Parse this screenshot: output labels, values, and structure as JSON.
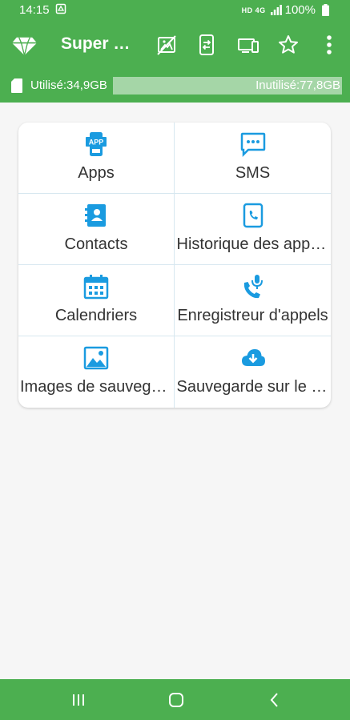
{
  "status_bar": {
    "time": "14:15",
    "network": "HD 4G",
    "battery": "100%"
  },
  "app_bar": {
    "title": "Super Backup",
    "icons": [
      "diamond-logo-icon",
      "no-image-icon",
      "phone-transfer-icon",
      "devices-icon",
      "star-icon",
      "more-vert-icon"
    ]
  },
  "storage": {
    "used_label": "Utilisé:34,9GB",
    "free_label": "Inutilisé:77,8GB",
    "used_fraction": 0.31
  },
  "tiles": [
    {
      "label": "Apps",
      "icon": "apps-icon"
    },
    {
      "label": "SMS",
      "icon": "sms-icon"
    },
    {
      "label": "Contacts",
      "icon": "contacts-icon"
    },
    {
      "label": "Historique des appels",
      "icon": "call-history-icon"
    },
    {
      "label": "Calendriers",
      "icon": "calendar-icon"
    },
    {
      "label": "Enregistreur d'appels",
      "icon": "call-recorder-icon"
    },
    {
      "label": "Images de sauvegarde",
      "icon": "image-icon"
    },
    {
      "label": "Sauvegarde sur le cloud",
      "icon": "cloud-download-icon"
    }
  ],
  "colors": {
    "primary": "#4caf50",
    "accent": "#1a9be0",
    "storage_free": "#a5d6a7"
  }
}
